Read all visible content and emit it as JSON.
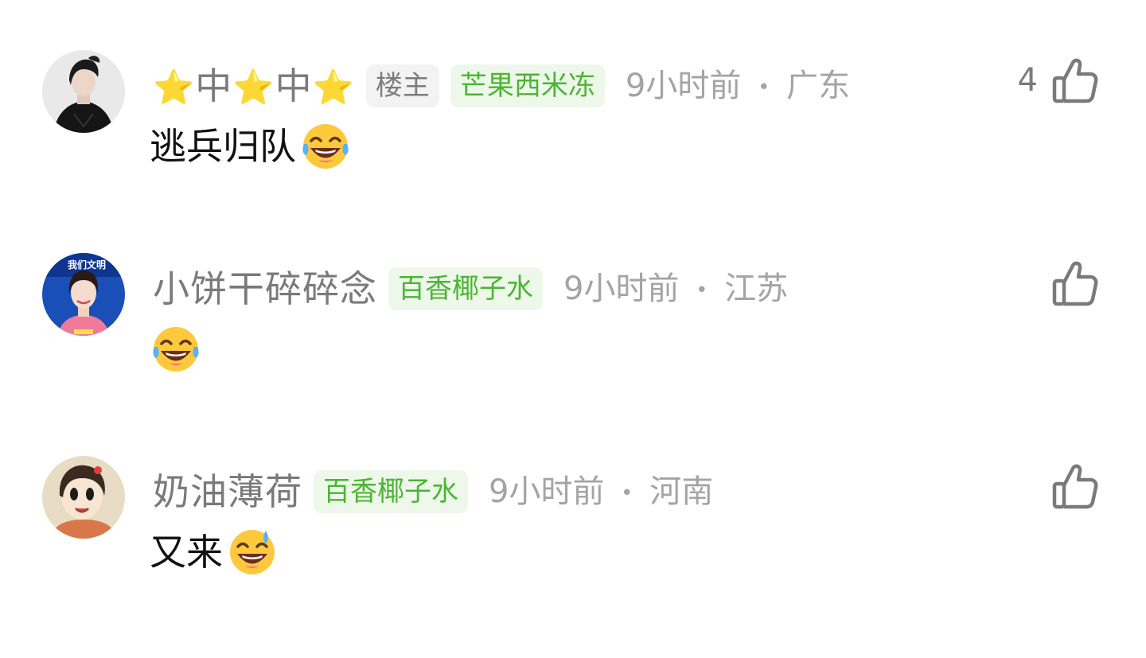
{
  "comments": [
    {
      "username_parts": [
        "⭐",
        "中",
        "⭐",
        "中",
        "⭐"
      ],
      "owner_badge": "楼主",
      "fan_badge": "芒果西米冻",
      "time": "9小时前",
      "separator": "•",
      "location": "广东",
      "like_count": "4",
      "text": "逃兵归队",
      "emoji": "tears-of-joy-emoji",
      "avatar_icon": "avatar-dark-outfit"
    },
    {
      "username": "小饼干碎碎念",
      "fan_badge": "百香椰子水",
      "time": "9小时前",
      "separator": "•",
      "location": "江苏",
      "like_count": "",
      "text": "",
      "emoji": "tears-of-joy-emoji",
      "avatar_icon": "avatar-news-anchor",
      "avatar_text": "我们文明"
    },
    {
      "username": "奶油薄荷",
      "fan_badge": "百香椰子水",
      "time": "9小时前",
      "separator": "•",
      "location": "河南",
      "like_count": "",
      "text": "又来",
      "emoji": "grinning-sweat-emoji",
      "avatar_icon": "avatar-cartoon-girl"
    }
  ],
  "colors": {
    "username": "#7a7a7a",
    "owner_badge_bg": "#f3f3f3",
    "fan_badge_bg": "#edf8ea",
    "fan_badge_text": "#4cb533",
    "time_text": "#a4a4a4",
    "content_text": "#111111"
  }
}
